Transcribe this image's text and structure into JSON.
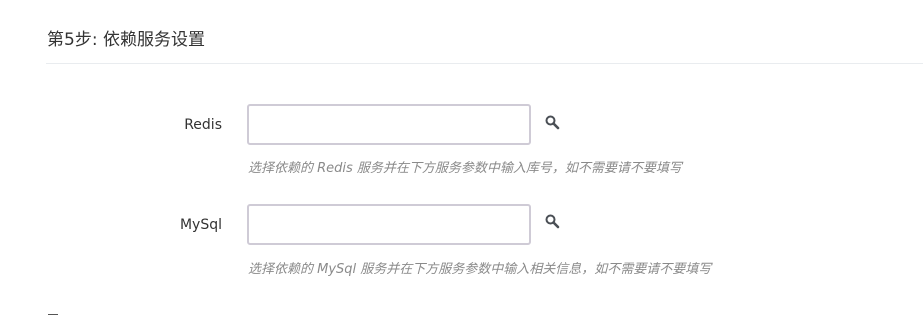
{
  "header": {
    "step_title": "第5步: 依赖服务设置"
  },
  "form": {
    "redis": {
      "label": "Redis",
      "value": "",
      "placeholder": "",
      "help": "选择依赖的 Redis 服务并在下方服务参数中输入库号，如不需要请不要填写",
      "search_icon": "search-icon"
    },
    "mysql": {
      "label": "MySql",
      "value": "",
      "placeholder": "",
      "help": "选择依赖的 MySql 服务并在下方服务参数中输入相关信息，如不需要请不要填写",
      "search_icon": "search-icon"
    }
  },
  "colors": {
    "input_border": "#cfcbd6",
    "help_text": "#8a8a8a",
    "icon": "#4a4f55"
  }
}
